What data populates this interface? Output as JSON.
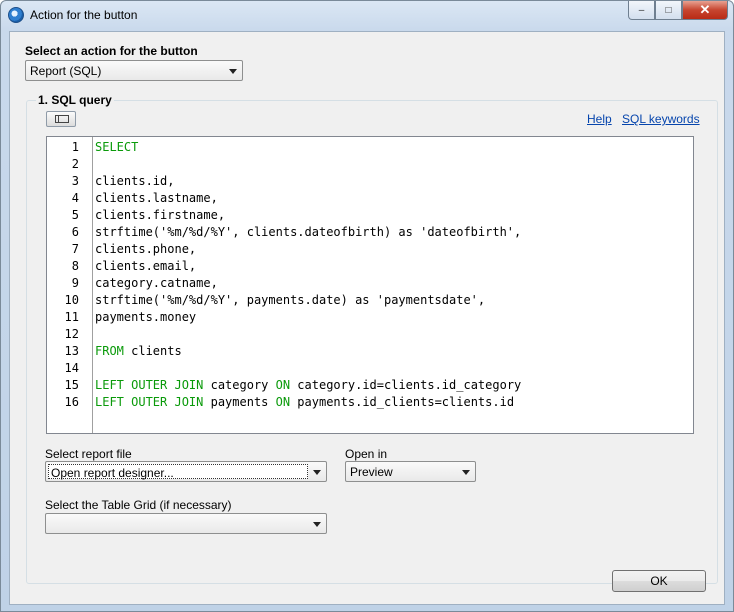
{
  "window": {
    "title": "Action for the button",
    "controls": {
      "minimize": "–",
      "maximize": "□",
      "close": "✕"
    }
  },
  "action": {
    "label": "Select an action for the button",
    "selected": "Report (SQL)"
  },
  "sql_group": {
    "title": "1. SQL query",
    "help_link": "Help",
    "keywords_link": "SQL keywords"
  },
  "editor": {
    "lines": [
      {
        "n": "1",
        "parts": [
          {
            "t": "SELECT",
            "k": true
          }
        ]
      },
      {
        "n": "2",
        "parts": []
      },
      {
        "n": "3",
        "parts": [
          {
            "t": "clients.id,",
            "k": false
          }
        ]
      },
      {
        "n": "4",
        "parts": [
          {
            "t": "clients.lastname,",
            "k": false
          }
        ]
      },
      {
        "n": "5",
        "parts": [
          {
            "t": "clients.firstname,",
            "k": false
          }
        ]
      },
      {
        "n": "6",
        "parts": [
          {
            "t": "strftime('%m/%d/%Y', clients.dateofbirth) as 'dateofbirth',",
            "k": false
          }
        ]
      },
      {
        "n": "7",
        "parts": [
          {
            "t": "clients.phone,",
            "k": false
          }
        ]
      },
      {
        "n": "8",
        "parts": [
          {
            "t": "clients.email,",
            "k": false
          }
        ]
      },
      {
        "n": "9",
        "parts": [
          {
            "t": "category.catname,",
            "k": false
          }
        ]
      },
      {
        "n": "10",
        "parts": [
          {
            "t": "strftime('%m/%d/%Y', payments.date) as 'paymentsdate',",
            "k": false
          }
        ]
      },
      {
        "n": "11",
        "parts": [
          {
            "t": "payments.money",
            "k": false
          }
        ]
      },
      {
        "n": "12",
        "parts": []
      },
      {
        "n": "13",
        "parts": [
          {
            "t": "FROM",
            "k": true
          },
          {
            "t": " clients",
            "k": false
          }
        ]
      },
      {
        "n": "14",
        "parts": []
      },
      {
        "n": "15",
        "parts": [
          {
            "t": "LEFT OUTER JOIN",
            "k": true
          },
          {
            "t": " category ",
            "k": false
          },
          {
            "t": "ON",
            "k": true
          },
          {
            "t": " category.id=clients.id_category",
            "k": false
          }
        ]
      },
      {
        "n": "16",
        "parts": [
          {
            "t": "LEFT OUTER JOIN",
            "k": true
          },
          {
            "t": " payments ",
            "k": false
          },
          {
            "t": "ON",
            "k": true
          },
          {
            "t": " payments.id_clients=clients.id",
            "k": false
          }
        ]
      }
    ],
    "keyword_color": "#0a9a0a"
  },
  "report_file": {
    "label": "Select report file",
    "selected": "Open report designer..."
  },
  "open_in": {
    "label": "Open in",
    "selected": "Preview"
  },
  "table_grid": {
    "label": "Select the Table Grid (if necessary)",
    "selected": ""
  },
  "buttons": {
    "ok": "OK"
  }
}
